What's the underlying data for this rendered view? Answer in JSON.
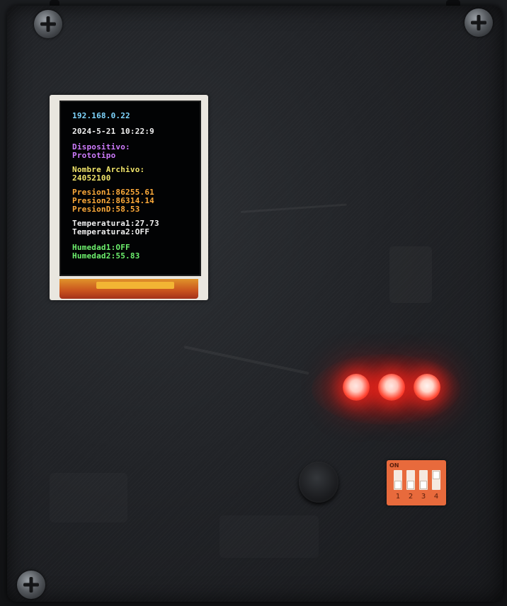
{
  "lcd": {
    "ip": "192.168.0.22",
    "datetime": "2024-5-21 10:22:9",
    "device_label": "Dispositivo:",
    "device_value": "Prototipo",
    "file_label": "Nombre Archivo:",
    "file_value": "24052100",
    "presion1": "Presion1:86255.61",
    "presion2": "Presion2:86314.14",
    "presion0": "PresionD:58.53",
    "temperatura1": "Temperatura1:27.73",
    "temperatura2": "Temperatura2:OFF",
    "humedad1": "Humedad1:OFF",
    "humedad2": "Humedad2:55.83"
  },
  "leds": {
    "count": 3,
    "color": "#ff3a2a",
    "state": "on"
  },
  "dip_switch": {
    "on_label": "ON",
    "positions": [
      "1",
      "2",
      "3",
      "4"
    ],
    "color": "#e86a3c"
  },
  "colors": {
    "enclosure": "#212327",
    "lcd_cyan": "#7fd6ff",
    "lcd_purple": "#d07cff",
    "lcd_yellow": "#f2e66a",
    "lcd_orange": "#ffab3a",
    "lcd_green": "#6df06d"
  }
}
